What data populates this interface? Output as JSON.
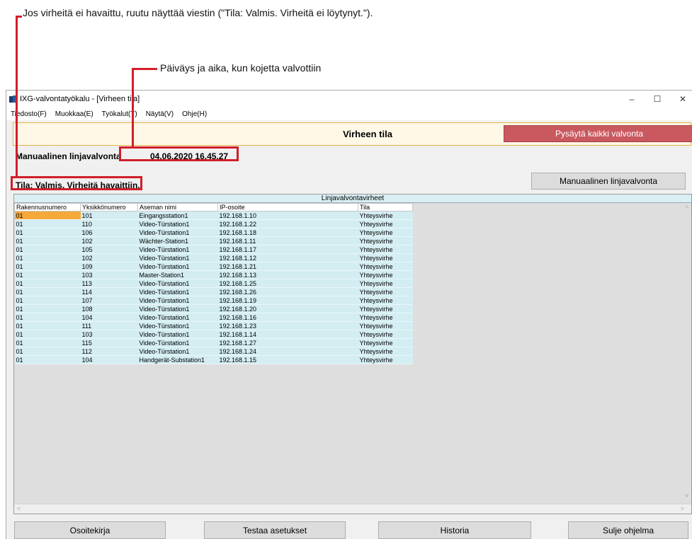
{
  "annotations": {
    "status_note": "Jos virheitä ei havaittu, ruutu näyttää viestin (\"Tila: Valmis. Virheitä ei löytynyt.\").",
    "datetime_note": "Päiväys ja aika, kun kojetta valvottiin"
  },
  "window": {
    "title": "IXG-valvontatyökalu - [Virheen tila]",
    "controls": {
      "minimize": "–",
      "maximize": "☐",
      "close": "✕"
    }
  },
  "menu": [
    {
      "label": "Tiedosto(F)"
    },
    {
      "label": "Muokkaa(E)"
    },
    {
      "label": "Työkalut(T)"
    },
    {
      "label": "Näytä(V)"
    },
    {
      "label": "Ohje(H)"
    }
  ],
  "header": {
    "title": "Virheen tila",
    "stop_button": "Pysäytä kaikki valvonta"
  },
  "info": {
    "manual_end_label": "Manuaalinen linjavalvonta päättyi",
    "manual_end_datetime": "04.06.2020 16.45.27",
    "status": "Tila: Valmis. Virheitä havaittiin."
  },
  "manual_button": "Manuaalinen linjavalvonta",
  "grid": {
    "caption": "Linjavalvontavirheet",
    "columns": [
      "Rakennusnumero",
      "Yksikkönumero",
      "Aseman nimi",
      "IP-osoite",
      "Tila"
    ],
    "rows": [
      [
        "01",
        "101",
        "Eingangsstation1",
        "192.168.1.10",
        "Yhteysvirhe"
      ],
      [
        "01",
        "110",
        "Video-Türstation1",
        "192.168.1.22",
        "Yhteysvirhe"
      ],
      [
        "01",
        "106",
        "Video-Türstation1",
        "192.168.1.18",
        "Yhteysvirhe"
      ],
      [
        "01",
        "102",
        "Wächter-Station1",
        "192.168.1.11",
        "Yhteysvirhe"
      ],
      [
        "01",
        "105",
        "Video-Türstation1",
        "192.168.1.17",
        "Yhteysvirhe"
      ],
      [
        "01",
        "102",
        "Video-Türstation1",
        "192.168.1.12",
        "Yhteysvirhe"
      ],
      [
        "01",
        "109",
        "Video-Türstation1",
        "192.168.1.21",
        "Yhteysvirhe"
      ],
      [
        "01",
        "103",
        "Master-Station1",
        "192.168.1.13",
        "Yhteysvirhe"
      ],
      [
        "01",
        "113",
        "Video-Türstation1",
        "192.168.1.25",
        "Yhteysvirhe"
      ],
      [
        "01",
        "114",
        "Video-Türstation1",
        "192.168.1.26",
        "Yhteysvirhe"
      ],
      [
        "01",
        "107",
        "Video-Türstation1",
        "192.168.1.19",
        "Yhteysvirhe"
      ],
      [
        "01",
        "108",
        "Video-Türstation1",
        "192.168.1.20",
        "Yhteysvirhe"
      ],
      [
        "01",
        "104",
        "Video-Türstation1",
        "192.168.1.16",
        "Yhteysvirhe"
      ],
      [
        "01",
        "111",
        "Video-Türstation1",
        "192.168.1.23",
        "Yhteysvirhe"
      ],
      [
        "01",
        "103",
        "Video-Türstation1",
        "192.168.1.14",
        "Yhteysvirhe"
      ],
      [
        "01",
        "115",
        "Video-Türstation1",
        "192.168.1.27",
        "Yhteysvirhe"
      ],
      [
        "01",
        "112",
        "Video-Türstation1",
        "192.168.1.24",
        "Yhteysvirhe"
      ],
      [
        "01",
        "104",
        "Handgerät-Substation1",
        "192.168.1.15",
        "Yhteysvirhe"
      ]
    ]
  },
  "bottom_buttons": [
    {
      "label": "Osoitekirja"
    },
    {
      "label": "Testaa asetukset"
    },
    {
      "label": "Historia"
    },
    {
      "label": "Sulje ohjelma"
    }
  ],
  "colors": {
    "annotation_red": "#d01f2a",
    "stop_button": "#c9595f",
    "row_background": "#d3edf2",
    "selected_cell": "#f6a93b",
    "header_panel": "#fff8e7"
  }
}
